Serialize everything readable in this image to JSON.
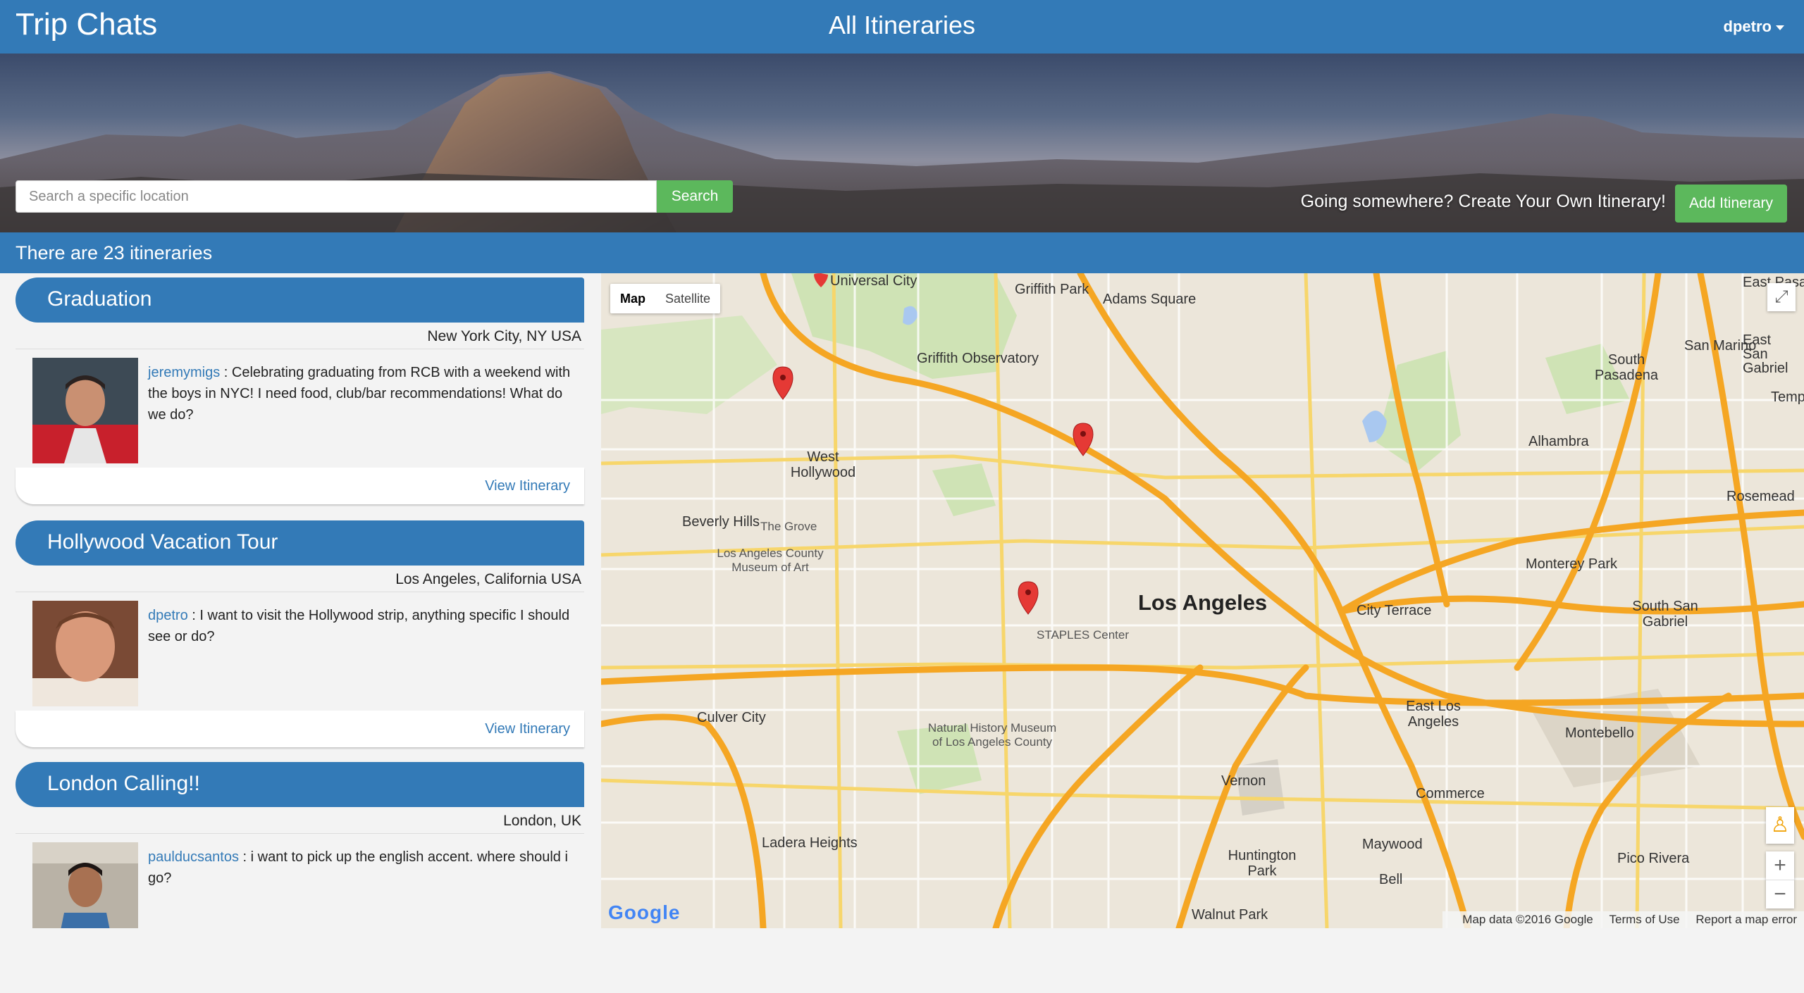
{
  "navbar": {
    "brand": "Trip Chats",
    "title": "All Itineraries",
    "user": "dpetro"
  },
  "hero": {
    "search_placeholder": "Search a specific location",
    "search_label": "Search",
    "cta_text": "Going somewhere? Create Your Own Itinerary!",
    "add_label": "Add Itinerary"
  },
  "count_text": "There are 23 itineraries",
  "itineraries": [
    {
      "title": "Graduation",
      "location": "New York City, NY USA",
      "user": "jeremymigs",
      "message": "Celebrating graduating from RCB with a weekend with the boys in NYC! I need food, club/bar recommendations! What do we do?",
      "link": "View Itinerary"
    },
    {
      "title": "Hollywood Vacation Tour",
      "location": "Los Angeles, California USA",
      "user": "dpetro",
      "message": "I want to visit the Hollywood strip, anything specific I should see or do?",
      "link": "View Itinerary"
    },
    {
      "title": "London Calling!!",
      "location": "London, UK",
      "user": "paulducsantos",
      "message": "i want to pick up the english accent. where should i go?",
      "link": ""
    }
  ],
  "map": {
    "type_map": "Map",
    "type_satellite": "Satellite",
    "attribution": {
      "data": "Map data ©2016 Google",
      "terms": "Terms of Use",
      "report": "Report a map error"
    },
    "logo": "Google",
    "labels": {
      "los_angeles": "Los Angeles",
      "beverly_hills": "Beverly Hills",
      "west_hollywood": "West Hollywood",
      "culver_city": "Culver City",
      "ladera_heights": "Ladera Heights",
      "huntington_park": "Huntington Park",
      "east_los_angeles": "East Los Angeles",
      "montebello": "Montebello",
      "alhambra": "Alhambra",
      "monterey_park": "Monterey Park",
      "south_pasadena": "South Pasadena",
      "san_marino": "San Marino",
      "rosemead": "Rosemead",
      "pico_rivera": "Pico Rivera",
      "commerce": "Commerce",
      "maywood": "Maywood",
      "bell": "Bell",
      "vernon": "Vernon",
      "city_terrace": "City Terrace",
      "adams_square": "Adams Square",
      "griffith_park": "Griffith Park",
      "griffith_obs": "Griffith Observatory",
      "staples": "STAPLES Center",
      "the_grove": "The Grove",
      "museum": "Natural History Museum of Los Angeles County",
      "east_pasadena": "East Pasadena",
      "temple_city": "Temple Cit",
      "south_san_gabriel": "South San Gabriel",
      "walnut_park": "Walnut Park",
      "lacma": "Los Angeles County Museum of Art",
      "east_san_gabriel": "East San Gabriel",
      "universal_city": "Universal City"
    }
  },
  "colors": {
    "primary": "#337ab7",
    "success": "#5cb85c",
    "background": "#f3f3f3"
  }
}
